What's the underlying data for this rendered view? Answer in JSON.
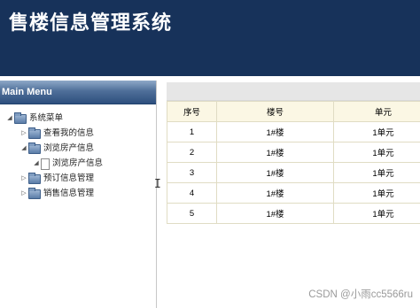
{
  "header": {
    "title": "售楼信息管理系统"
  },
  "menu": {
    "title": "Main Menu",
    "tree": [
      {
        "label": "系统菜单",
        "expander": "◢",
        "icon": "folder-icon"
      },
      {
        "label": "查看我的信息",
        "expander": "▷",
        "icon": "folder-icon"
      },
      {
        "label": "浏览房产信息",
        "expander": "◢",
        "icon": "folder-icon"
      },
      {
        "label": "浏览房产信息",
        "expander": "◢",
        "icon": "document-icon"
      },
      {
        "label": "预订信息管理",
        "expander": "▷",
        "icon": "folder-icon"
      },
      {
        "label": "销售信息管理",
        "expander": "▷",
        "icon": "folder-icon"
      }
    ]
  },
  "table": {
    "columns": [
      "序号",
      "楼号",
      "单元"
    ],
    "rows": [
      [
        "1",
        "1#楼",
        "1单元"
      ],
      [
        "2",
        "1#楼",
        "1单元"
      ],
      [
        "3",
        "1#楼",
        "1单元"
      ],
      [
        "4",
        "1#楼",
        "1单元"
      ],
      [
        "5",
        "1#楼",
        "1单元"
      ]
    ]
  },
  "watermark": "CSDN @小雨cc5566ru",
  "colors": {
    "header_bg": "#17325a",
    "menu_title_bg": "#4f6f99",
    "table_header_bg": "#fbf7e4"
  }
}
